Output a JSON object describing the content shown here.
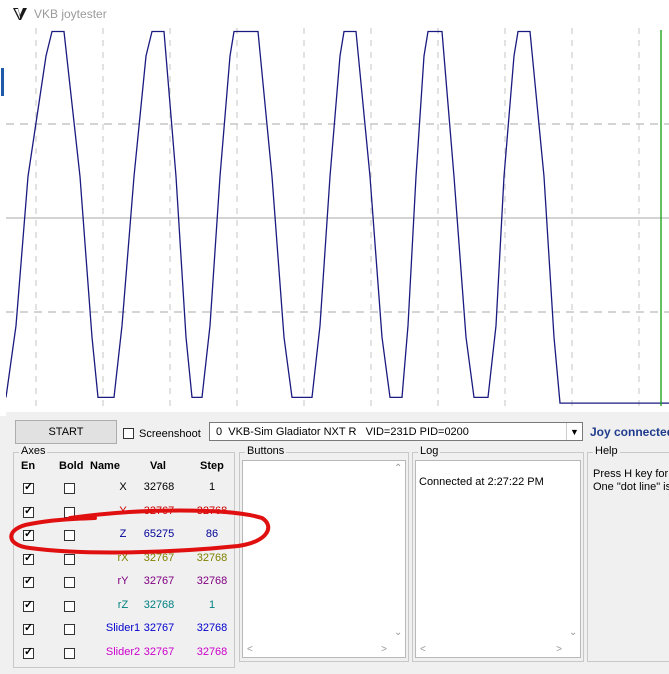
{
  "window": {
    "title": "VKB joytester"
  },
  "chart_data": {
    "type": "line",
    "title": "",
    "xlabel": "",
    "ylabel": "",
    "ylim": [
      0,
      65535
    ],
    "grid": true,
    "series": [
      {
        "color": "#1a1a80",
        "points": [
          [
            0,
            1500
          ],
          [
            10,
            14000
          ],
          [
            22,
            40000
          ],
          [
            40,
            61000
          ],
          [
            46,
            65275
          ],
          [
            58,
            65275
          ],
          [
            74,
            40000
          ],
          [
            86,
            12000
          ],
          [
            92,
            1500
          ],
          [
            108,
            1500
          ],
          [
            116,
            14000
          ],
          [
            128,
            40000
          ],
          [
            140,
            61000
          ],
          [
            146,
            65275
          ],
          [
            158,
            65275
          ],
          [
            170,
            40000
          ],
          [
            180,
            12000
          ],
          [
            186,
            1500
          ],
          [
            196,
            1500
          ],
          [
            204,
            14000
          ],
          [
            214,
            40000
          ],
          [
            224,
            61000
          ],
          [
            228,
            65275
          ],
          [
            252,
            65275
          ],
          [
            266,
            40000
          ],
          [
            278,
            12000
          ],
          [
            286,
            1500
          ],
          [
            306,
            1500
          ],
          [
            314,
            14000
          ],
          [
            324,
            40000
          ],
          [
            334,
            61000
          ],
          [
            338,
            65275
          ],
          [
            350,
            65275
          ],
          [
            364,
            40000
          ],
          [
            376,
            12000
          ],
          [
            384,
            1500
          ],
          [
            396,
            1500
          ],
          [
            402,
            14000
          ],
          [
            410,
            40000
          ],
          [
            418,
            61000
          ],
          [
            422,
            65275
          ],
          [
            436,
            65275
          ],
          [
            448,
            40000
          ],
          [
            460,
            12000
          ],
          [
            468,
            1500
          ],
          [
            482,
            1500
          ],
          [
            490,
            14000
          ],
          [
            498,
            40000
          ],
          [
            508,
            61000
          ],
          [
            512,
            65275
          ],
          [
            524,
            65275
          ],
          [
            538,
            40000
          ],
          [
            548,
            12000
          ],
          [
            554,
            500
          ],
          [
            663,
            500
          ]
        ]
      },
      {
        "color": "#10a010",
        "points": [
          [
            655,
            0
          ],
          [
            655,
            65535
          ]
        ]
      }
    ]
  },
  "toolbar": {
    "start_label": "START",
    "screenshot_label": "Screenshoot",
    "screenshot_checked": false,
    "device": "0  VKB-Sim Gladiator NXT R   VID=231D PID=0200",
    "status": "Joy connected"
  },
  "axes": {
    "caption": "Axes",
    "headers": {
      "en": "En",
      "bold": "Bold",
      "name": "Name",
      "val": "Val",
      "step": "Step"
    },
    "rows": [
      {
        "name": "X",
        "val": "32768",
        "step": "1",
        "color": "#000000",
        "enabled": true,
        "bold": false
      },
      {
        "name": "Y",
        "val": "32767",
        "step": "32768",
        "color": "#cc0000",
        "enabled": true,
        "bold": false
      },
      {
        "name": "Z",
        "val": "65275",
        "step": "86",
        "color": "#000099",
        "enabled": true,
        "bold": false
      },
      {
        "name": "rX",
        "val": "32767",
        "step": "32768",
        "color": "#808000",
        "enabled": true,
        "bold": false
      },
      {
        "name": "rY",
        "val": "32767",
        "step": "32768",
        "color": "#800080",
        "enabled": true,
        "bold": false
      },
      {
        "name": "rZ",
        "val": "32768",
        "step": "1",
        "color": "#008080",
        "enabled": true,
        "bold": false
      },
      {
        "name": "Slider1",
        "val": "32767",
        "step": "32768",
        "color": "#0000cc",
        "enabled": true,
        "bold": false
      },
      {
        "name": "Slider2",
        "val": "32767",
        "step": "32768",
        "color": "#cc00cc",
        "enabled": true,
        "bold": false
      }
    ]
  },
  "buttons_panel": {
    "caption": "Buttons"
  },
  "log_panel": {
    "caption": "Log",
    "entries": [
      "Connected at 2:27:22 PM"
    ]
  },
  "help_panel": {
    "caption": "Help",
    "text": "Press H key for\nOne \"dot line\" is"
  },
  "annotation": {
    "color": "#e01010",
    "target": "Z"
  }
}
